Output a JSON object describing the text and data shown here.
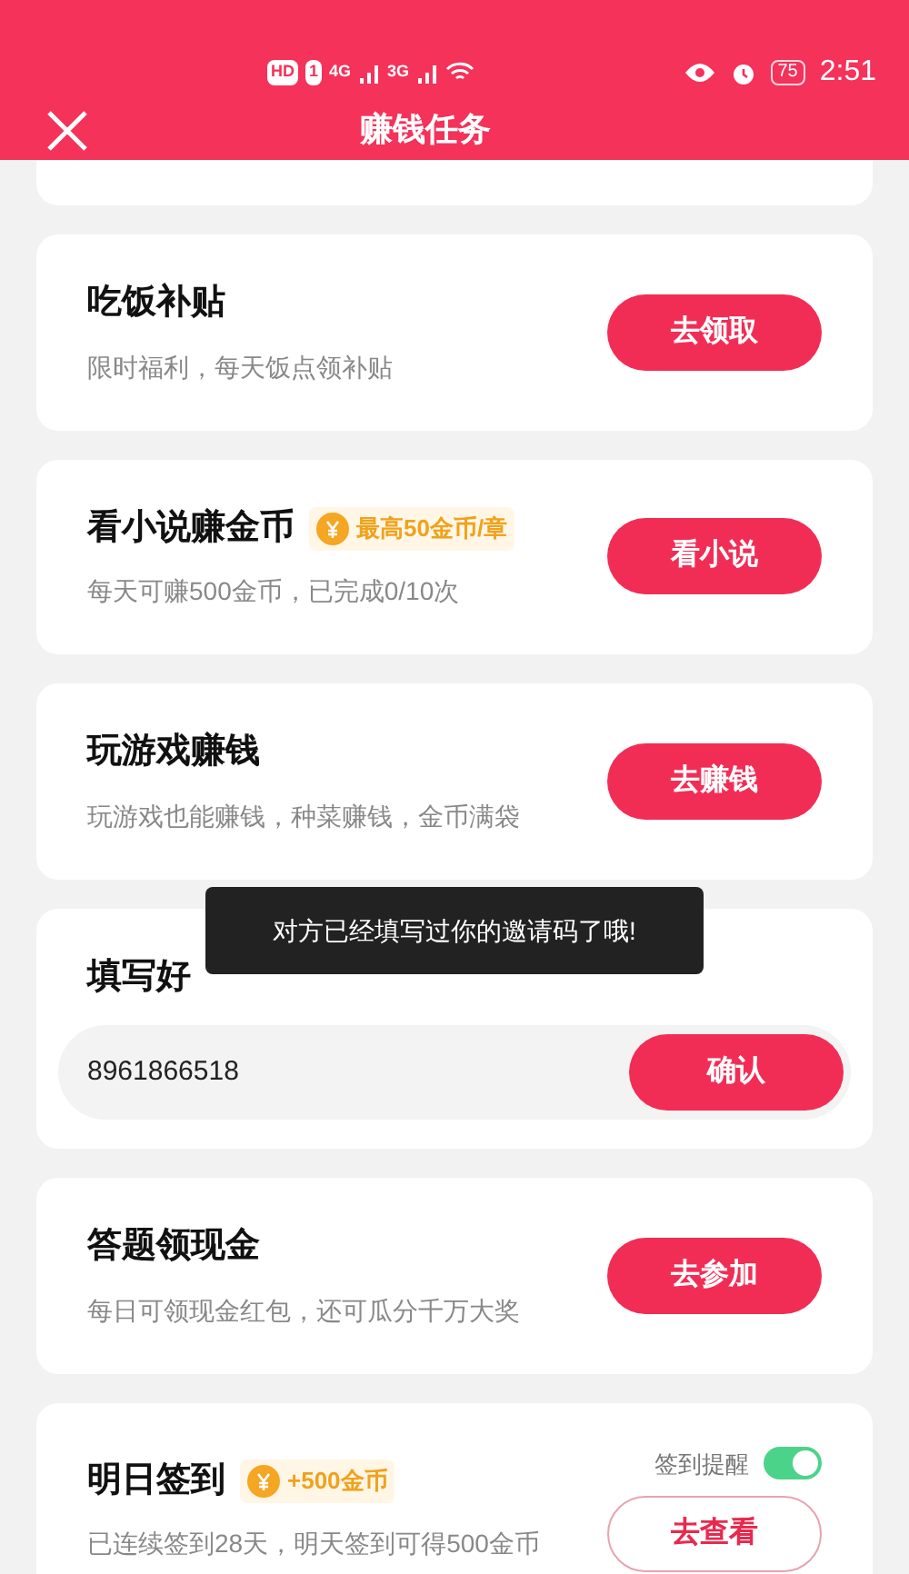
{
  "status_bar": {
    "hd": "HD",
    "sim": "1",
    "net_1": "4G",
    "net_2": "3G",
    "battery": "75",
    "time": "2:51"
  },
  "header": {
    "title": "赚钱任务"
  },
  "tasks": [
    {
      "kind": "partial"
    },
    {
      "kind": "task",
      "title": "吃饭补贴",
      "subtitle": "限时福利，每天饭点领补贴",
      "button": {
        "label": "去领取"
      }
    },
    {
      "kind": "task",
      "title": "看小说赚金币",
      "badge": "最高50金币/章",
      "subtitle": "每天可赚500金币，已完成0/10次",
      "button": {
        "label": "看小说"
      }
    },
    {
      "kind": "task",
      "title": "玩游戏赚钱",
      "subtitle": "玩游戏也能赚钱，种菜赚钱，金币满袋",
      "button": {
        "label": "去赚钱"
      }
    },
    {
      "kind": "invite",
      "title": "填写好",
      "value": "8961866518",
      "button": {
        "label": "确认"
      }
    },
    {
      "kind": "task",
      "title": "答题领现金",
      "subtitle": "每日可领现金红包，还可瓜分千万大奖",
      "button": {
        "label": "去参加"
      }
    },
    {
      "kind": "signin",
      "title": "明日签到",
      "badge": "+500金币",
      "subtitle": "已连续签到28天，明天签到可得500金币",
      "reminder": {
        "label": "签到提醒",
        "on": true
      },
      "button": {
        "label": "去查看"
      }
    }
  ],
  "toast": {
    "text": "对方已经填写过你的邀请码了哦!"
  }
}
